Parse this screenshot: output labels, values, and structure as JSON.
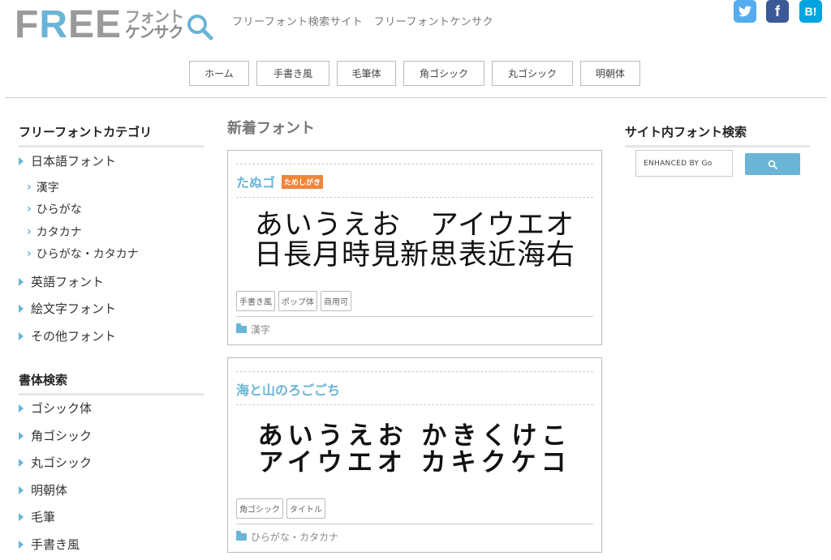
{
  "header": {
    "logo_letters": [
      "F",
      "R",
      "E",
      "E"
    ],
    "logo_kana_top": "フォント",
    "logo_kana_bottom": "ケンサク",
    "tagline": "フリーフォント検索サイト　フリーフォントケンサク",
    "social": {
      "twitter_icon": "twitter-bird",
      "facebook_label": "f",
      "hatena_label": "B!"
    }
  },
  "nav": [
    "ホーム",
    "手書き風",
    "毛筆体",
    "角ゴシック",
    "丸ゴシック",
    "明朝体"
  ],
  "sidebar": {
    "category_title": "フリーフォントカテゴリ",
    "categories": [
      "日本語フォント",
      "英語フォント",
      "絵文字フォント",
      "その他フォント"
    ],
    "sub_categories": [
      "漢字",
      "ひらがな",
      "カタカナ",
      "ひらがな・カタカナ"
    ],
    "style_title": "書体検索",
    "styles": [
      "ゴシック体",
      "角ゴシック",
      "丸ゴシック",
      "明朝体",
      "毛筆",
      "手書き風"
    ]
  },
  "main": {
    "title": "新着フォント",
    "cards": [
      {
        "name": "たぬゴ",
        "badge": "ためしがき",
        "sample_line1": "あいうえお　アイウエオ",
        "sample_line2": "日長月時見新思表近海右",
        "tags": [
          "手書き風",
          "ポップ体",
          "商用可"
        ],
        "category": "漢字"
      },
      {
        "name": "海と山のろごごち",
        "sample_line1": "あいうえお かきくけこ",
        "sample_line2": "アイウエオ カキクケコ",
        "tags": [
          "角ゴシック",
          "タイトル"
        ],
        "category": "ひらがな・カタカナ"
      }
    ]
  },
  "right_sidebar": {
    "title": "サイト内フォント検索",
    "search_placeholder": "ENHANCED BY Go",
    "search_icon": "magnifier-icon"
  },
  "colors": {
    "accent": "#6ab4d6",
    "badge": "#f0853a",
    "twitter": "#55acee",
    "facebook": "#3b5998",
    "hatena": "#00a4de"
  }
}
